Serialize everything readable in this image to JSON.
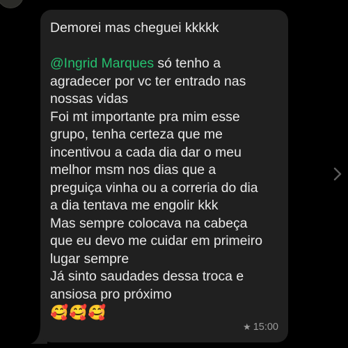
{
  "message": {
    "first_line": "Demorei mas cheguei kkkkk",
    "mention": "@Ingrid Marques",
    "mention_rest": " só tenho a",
    "lines": [
      "agradecer por vc ter entrado nas",
      "nossas vidas",
      "Foi mt importante pra mim esse",
      "grupo, tenha certeza que me",
      "incentivou a cada dia dar o meu",
      "melhor msm nos dias que a",
      "preguiça vinha ou a correria do dia",
      "a dia tentava me engolir kkk",
      "Mas sempre colocava na cabeça",
      "que eu devo me cuidar em primeiro",
      "lugar sempre",
      "Já sinto saudades dessa troca e",
      "ansiosa pro próximo"
    ],
    "emojis": [
      "🥰",
      "🥰",
      "🥰"
    ],
    "star_glyph": "★",
    "time": "15:00"
  },
  "colors": {
    "background": "#000000",
    "bubble": "#202020",
    "text": "#e9e9e9",
    "mention": "#25c16f",
    "meta": "#9a9a9a"
  },
  "icons": {
    "star": "star-icon",
    "chevron": "chevron-right-icon",
    "avatar": "avatar"
  }
}
